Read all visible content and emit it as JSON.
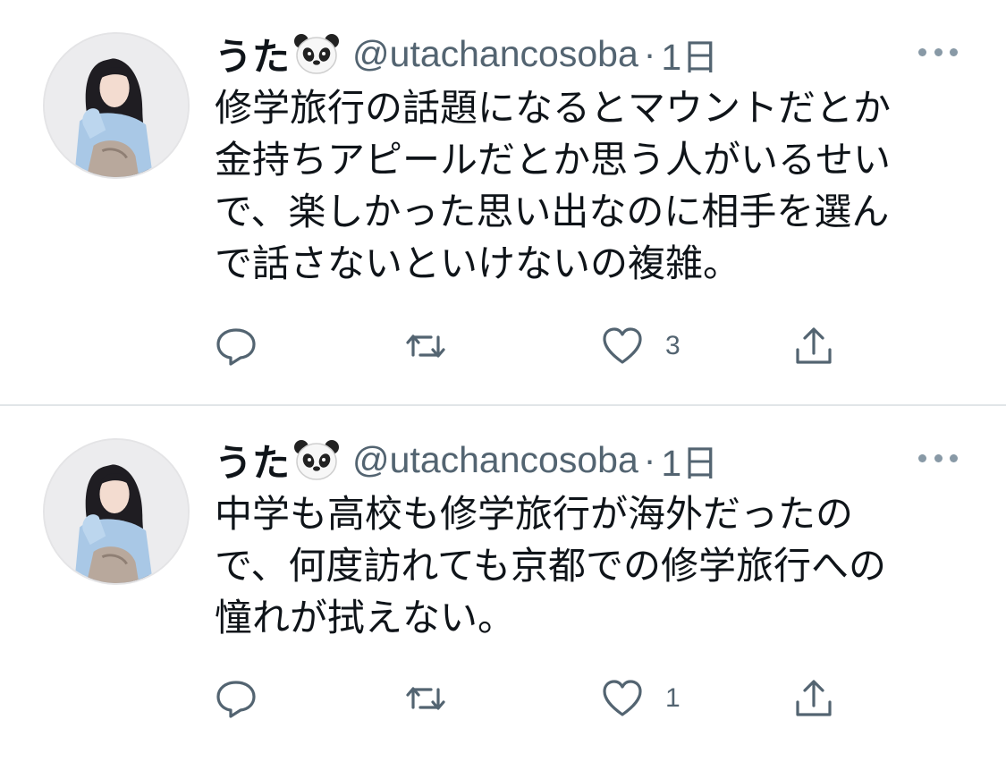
{
  "tweets": [
    {
      "display_name": "うた",
      "emoji_icon": "panda-face-icon",
      "handle": "@utachancosoba",
      "separator": "·",
      "time": "1日",
      "lines": [
        "修学旅行の話題になるとマウントだとか",
        "金持ちアピールだとか思う人がいるせい",
        "で、楽しかった思い出なのに相手を選ん",
        "で話さないといけないの複雑。"
      ],
      "like_count": "3"
    },
    {
      "display_name": "うた",
      "emoji_icon": "panda-face-icon",
      "handle": "@utachancosoba",
      "separator": "·",
      "time": "1日",
      "lines": [
        "中学も高校も修学旅行が海外だったの",
        "で、何度訪れても京都での修学旅行への",
        "憧れが拭えない。"
      ],
      "like_count": "1"
    }
  ],
  "colors": {
    "text": "#0f1419",
    "secondary": "#536471",
    "divider": "#e1e5e8"
  }
}
